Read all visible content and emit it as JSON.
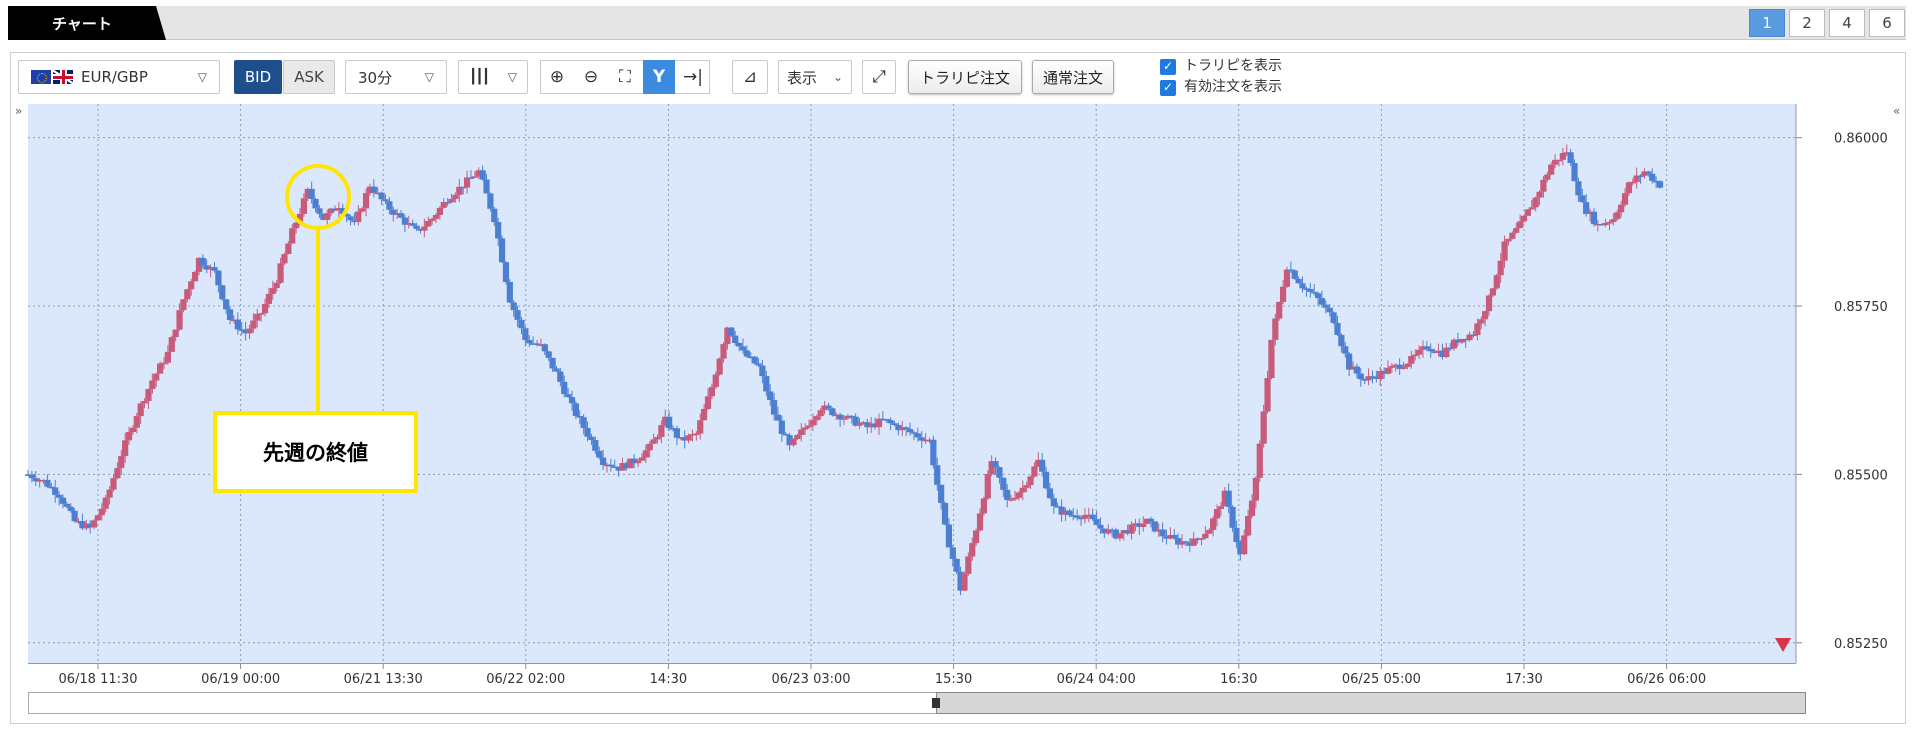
{
  "tabs": {
    "active_label": "チャート"
  },
  "layout_buttons": [
    "1",
    "2",
    "4",
    "6"
  ],
  "layout_active": "1",
  "toolbar": {
    "pair_label": "EUR/GBP",
    "bid_label": "BID",
    "ask_label": "ASK",
    "interval_label": "30分",
    "display_label": "表示",
    "trap_order_label": "トラリピ注文",
    "normal_order_label": "通常注文",
    "checkbox_show_trap": "トラリピを表示",
    "checkbox_show_orders": "有効注文を表示"
  },
  "annotation": {
    "label": "先週の終値"
  },
  "colors": {
    "bull": "#c85a7a",
    "bear": "#4d7fd0",
    "plot_bg": "#dbe8fb",
    "highlight": "#ffe600",
    "marker": "#d8344a"
  },
  "chart_data": {
    "type": "candlestick",
    "title": "",
    "xlabel": "",
    "ylabel": "",
    "ylim": [
      0.8522,
      0.8605
    ],
    "y_ticks": [
      "0.86000",
      "0.85750",
      "0.85500",
      "0.85250"
    ],
    "x_ticks": [
      "06/18 11:30",
      "06/19 00:00",
      "06/21 13:30",
      "06/22 02:00",
      "14:30",
      "06/23 03:00",
      "15:30",
      "06/24 04:00",
      "16:30",
      "06/25 05:00",
      "17:30",
      "06/26 06:00"
    ],
    "close_path": [
      [
        0,
        0.855
      ],
      [
        2,
        0.8549
      ],
      [
        4,
        0.8547
      ],
      [
        6,
        0.8543
      ],
      [
        8,
        0.8542
      ],
      [
        10,
        0.8546
      ],
      [
        12,
        0.8553
      ],
      [
        14,
        0.8559
      ],
      [
        16,
        0.8564
      ],
      [
        18,
        0.8568
      ],
      [
        20,
        0.8576
      ],
      [
        22,
        0.8582
      ],
      [
        24,
        0.858
      ],
      [
        26,
        0.8573
      ],
      [
        28,
        0.8571
      ],
      [
        30,
        0.8574
      ],
      [
        32,
        0.8579
      ],
      [
        34,
        0.8586
      ],
      [
        36,
        0.8592
      ],
      [
        38,
        0.8588
      ],
      [
        40,
        0.859
      ],
      [
        42,
        0.8587
      ],
      [
        44,
        0.8593
      ],
      [
        46,
        0.859
      ],
      [
        48,
        0.8588
      ],
      [
        50,
        0.8586
      ],
      [
        52,
        0.8588
      ],
      [
        54,
        0.8591
      ],
      [
        56,
        0.8593
      ],
      [
        58,
        0.8595
      ],
      [
        60,
        0.8588
      ],
      [
        62,
        0.8576
      ],
      [
        64,
        0.857
      ],
      [
        66,
        0.8569
      ],
      [
        68,
        0.8565
      ],
      [
        70,
        0.856
      ],
      [
        72,
        0.8556
      ],
      [
        74,
        0.8552
      ],
      [
        76,
        0.8551
      ],
      [
        78,
        0.8552
      ],
      [
        80,
        0.8554
      ],
      [
        82,
        0.8558
      ],
      [
        84,
        0.8555
      ],
      [
        86,
        0.8556
      ],
      [
        88,
        0.8563
      ],
      [
        90,
        0.8572
      ],
      [
        92,
        0.8568
      ],
      [
        94,
        0.8566
      ],
      [
        96,
        0.8559
      ],
      [
        98,
        0.8554
      ],
      [
        100,
        0.8557
      ],
      [
        102,
        0.856
      ],
      [
        104,
        0.8559
      ],
      [
        106,
        0.8558
      ],
      [
        108,
        0.8557
      ],
      [
        110,
        0.8558
      ],
      [
        112,
        0.8557
      ],
      [
        114,
        0.8556
      ],
      [
        116,
        0.8555
      ],
      [
        118,
        0.8542
      ],
      [
        120,
        0.8533
      ],
      [
        122,
        0.8542
      ],
      [
        124,
        0.8552
      ],
      [
        126,
        0.8546
      ],
      [
        128,
        0.8548
      ],
      [
        130,
        0.8552
      ],
      [
        132,
        0.8545
      ],
      [
        134,
        0.8544
      ],
      [
        136,
        0.8544
      ],
      [
        138,
        0.8542
      ],
      [
        140,
        0.8541
      ],
      [
        142,
        0.8542
      ],
      [
        144,
        0.8543
      ],
      [
        146,
        0.8541
      ],
      [
        148,
        0.854
      ],
      [
        150,
        0.854
      ],
      [
        152,
        0.8542
      ],
      [
        154,
        0.8547
      ],
      [
        156,
        0.8538
      ],
      [
        158,
        0.8549
      ],
      [
        160,
        0.857
      ],
      [
        162,
        0.8581
      ],
      [
        164,
        0.8578
      ],
      [
        166,
        0.8576
      ],
      [
        168,
        0.8573
      ],
      [
        170,
        0.8566
      ],
      [
        172,
        0.8564
      ],
      [
        174,
        0.8565
      ],
      [
        176,
        0.8566
      ],
      [
        178,
        0.8567
      ],
      [
        180,
        0.8569
      ],
      [
        182,
        0.8568
      ],
      [
        184,
        0.857
      ],
      [
        186,
        0.8571
      ],
      [
        188,
        0.8576
      ],
      [
        190,
        0.8584
      ],
      [
        192,
        0.8587
      ],
      [
        194,
        0.8591
      ],
      [
        196,
        0.8596
      ],
      [
        198,
        0.8598
      ],
      [
        200,
        0.859
      ],
      [
        202,
        0.8587
      ],
      [
        204,
        0.8588
      ],
      [
        206,
        0.8593
      ],
      [
        208,
        0.8595
      ],
      [
        210,
        0.8593
      ]
    ]
  }
}
